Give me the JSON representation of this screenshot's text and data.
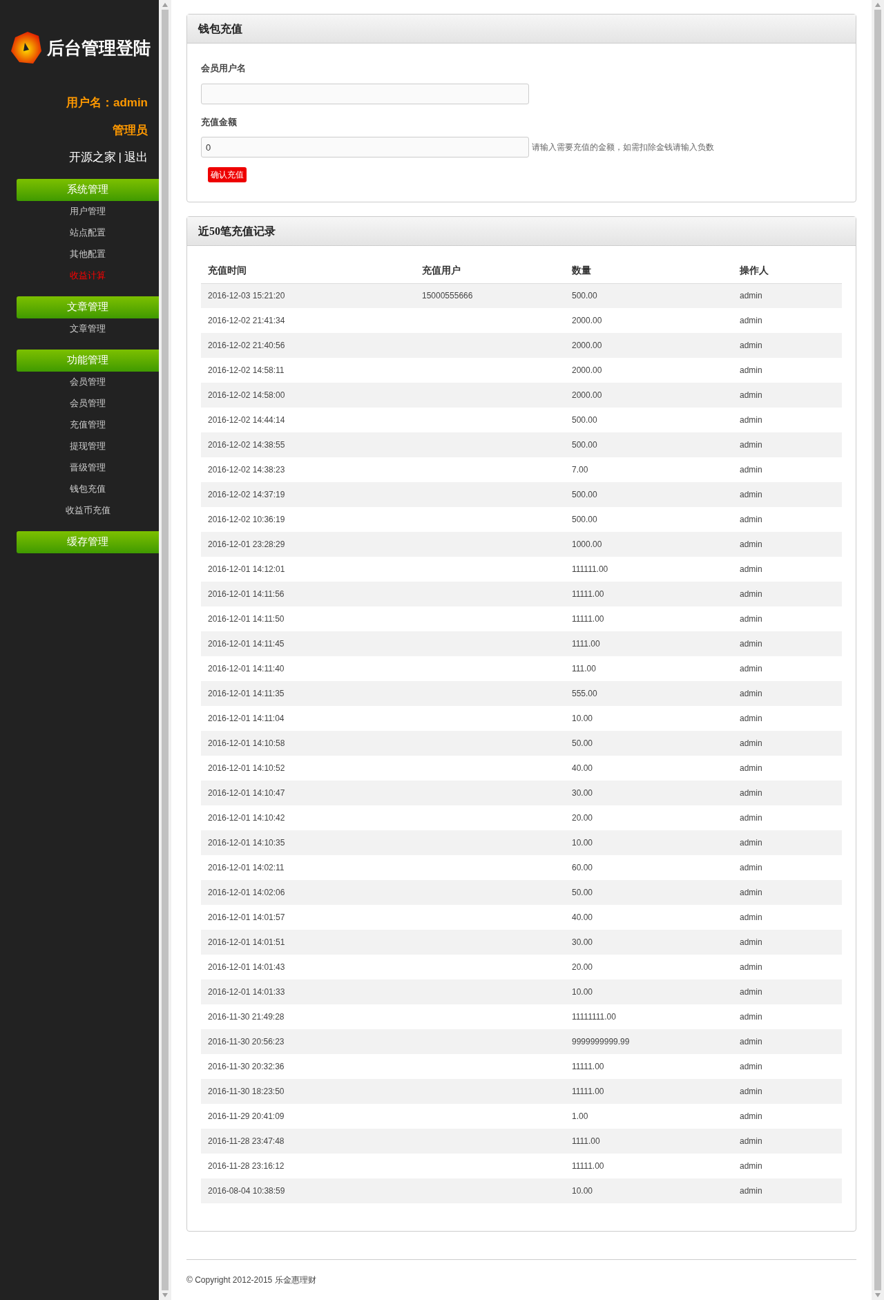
{
  "sidebar": {
    "logo_text": "后台管理登陆",
    "user_label": "用户名：admin",
    "role": "管理员",
    "links": [
      "开源之家",
      "退出"
    ],
    "link_separator": "|",
    "groups": [
      {
        "title": "系统管理",
        "items": [
          {
            "label": "用户管理",
            "selected": false
          },
          {
            "label": "站点配置",
            "selected": false
          },
          {
            "label": "其他配置",
            "selected": false
          },
          {
            "label": "收益计算",
            "selected": true
          }
        ]
      },
      {
        "title": "文章管理",
        "items": [
          {
            "label": "文章管理",
            "selected": false
          }
        ]
      },
      {
        "title": "功能管理",
        "items": [
          {
            "label": "会员管理",
            "selected": false
          },
          {
            "label": "会员管理",
            "selected": false
          },
          {
            "label": "充值管理",
            "selected": false
          },
          {
            "label": "提现管理",
            "selected": false
          },
          {
            "label": "晋级管理",
            "selected": false
          },
          {
            "label": "钱包充值",
            "selected": false
          },
          {
            "label": "收益币充值",
            "selected": false
          }
        ]
      },
      {
        "title": "缓存管理"
      }
    ]
  },
  "form": {
    "title": "钱包充值",
    "username_label": "会员用户名",
    "amount_label": "充值金额",
    "amount_value": "0",
    "amount_hint": "请输入需要充值的金额，如需扣除金钱请输入负数",
    "submit": "确认充值"
  },
  "records": {
    "title": "近50笔充值记录",
    "columns": [
      "充值时间",
      "充值用户",
      "数量",
      "操作人"
    ],
    "rows": [
      [
        "2016-12-03 15:21:20",
        "15000555666",
        "500.00",
        "admin"
      ],
      [
        "2016-12-02 21:41:34",
        "",
        "2000.00",
        "admin"
      ],
      [
        "2016-12-02 21:40:56",
        "",
        "2000.00",
        "admin"
      ],
      [
        "2016-12-02 14:58:11",
        "",
        "2000.00",
        "admin"
      ],
      [
        "2016-12-02 14:58:00",
        "",
        "2000.00",
        "admin"
      ],
      [
        "2016-12-02 14:44:14",
        "",
        "500.00",
        "admin"
      ],
      [
        "2016-12-02 14:38:55",
        "",
        "500.00",
        "admin"
      ],
      [
        "2016-12-02 14:38:23",
        "",
        "7.00",
        "admin"
      ],
      [
        "2016-12-02 14:37:19",
        "",
        "500.00",
        "admin"
      ],
      [
        "2016-12-02 10:36:19",
        "",
        "500.00",
        "admin"
      ],
      [
        "2016-12-01 23:28:29",
        "",
        "1000.00",
        "admin"
      ],
      [
        "2016-12-01 14:12:01",
        "",
        "111111.00",
        "admin"
      ],
      [
        "2016-12-01 14:11:56",
        "",
        "11111.00",
        "admin"
      ],
      [
        "2016-12-01 14:11:50",
        "",
        "11111.00",
        "admin"
      ],
      [
        "2016-12-01 14:11:45",
        "",
        "1111.00",
        "admin"
      ],
      [
        "2016-12-01 14:11:40",
        "",
        "111.00",
        "admin"
      ],
      [
        "2016-12-01 14:11:35",
        "",
        "555.00",
        "admin"
      ],
      [
        "2016-12-01 14:11:04",
        "",
        "10.00",
        "admin"
      ],
      [
        "2016-12-01 14:10:58",
        "",
        "50.00",
        "admin"
      ],
      [
        "2016-12-01 14:10:52",
        "",
        "40.00",
        "admin"
      ],
      [
        "2016-12-01 14:10:47",
        "",
        "30.00",
        "admin"
      ],
      [
        "2016-12-01 14:10:42",
        "",
        "20.00",
        "admin"
      ],
      [
        "2016-12-01 14:10:35",
        "",
        "10.00",
        "admin"
      ],
      [
        "2016-12-01 14:02:11",
        "",
        "60.00",
        "admin"
      ],
      [
        "2016-12-01 14:02:06",
        "",
        "50.00",
        "admin"
      ],
      [
        "2016-12-01 14:01:57",
        "",
        "40.00",
        "admin"
      ],
      [
        "2016-12-01 14:01:51",
        "",
        "30.00",
        "admin"
      ],
      [
        "2016-12-01 14:01:43",
        "",
        "20.00",
        "admin"
      ],
      [
        "2016-12-01 14:01:33",
        "",
        "10.00",
        "admin"
      ],
      [
        "2016-11-30 21:49:28",
        "",
        "11111111.00",
        "admin"
      ],
      [
        "2016-11-30 20:56:23",
        "",
        "9999999999.99",
        "admin"
      ],
      [
        "2016-11-30 20:32:36",
        "",
        "11111.00",
        "admin"
      ],
      [
        "2016-11-30 18:23:50",
        "",
        "11111.00",
        "admin"
      ],
      [
        "2016-11-29 20:41:09",
        "",
        "1.00",
        "admin"
      ],
      [
        "2016-11-28 23:47:48",
        "",
        "1111.00",
        "admin"
      ],
      [
        "2016-11-28 23:16:12",
        "",
        "11111.00",
        "admin"
      ],
      [
        "2016-08-04 10:38:59",
        "",
        "10.00",
        "admin"
      ]
    ]
  },
  "footer": "© Copyright 2012-2015 乐金惠理财"
}
